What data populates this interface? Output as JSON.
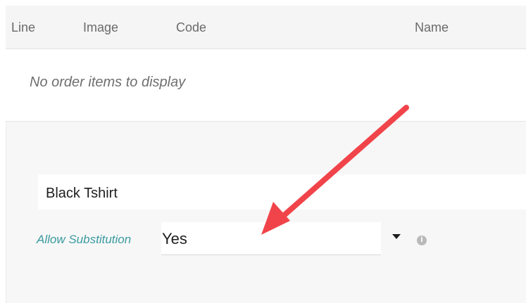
{
  "table": {
    "columns": [
      "Line",
      "Image",
      "Code",
      "Name"
    ],
    "empty_message": "No order items to display"
  },
  "item": {
    "name": "Black Tshirt",
    "substitution_label": "Allow Substitution",
    "substitution_value": "Yes"
  },
  "icons": {
    "dropdown": "caret-down-icon",
    "info": "info-icon",
    "annotation": "red-arrow"
  },
  "colors": {
    "label_accent": "#3a9aa0",
    "arrow": "#f0444a",
    "header_bg": "#f5f5f5",
    "panel_bg": "#f7f7f7"
  }
}
